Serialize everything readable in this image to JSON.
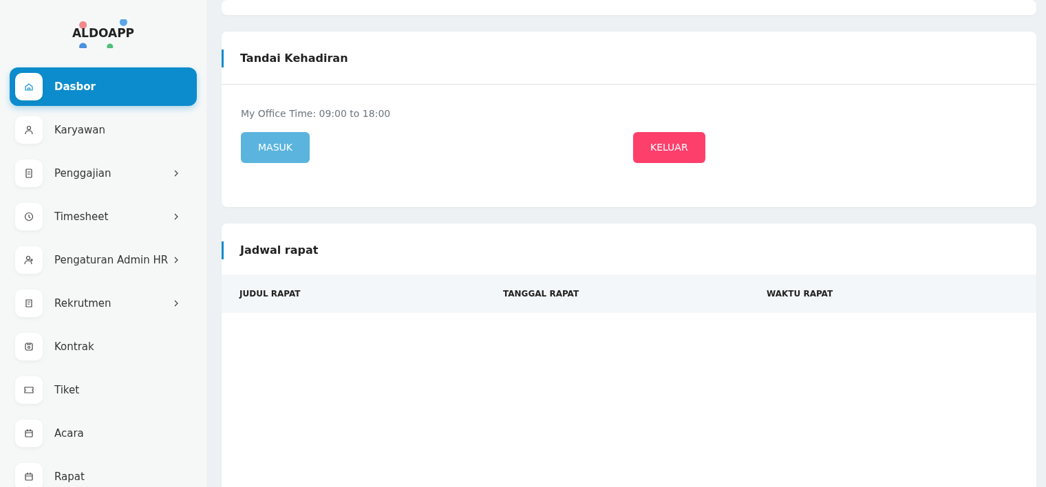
{
  "logo": {
    "text": "ALDOAPP"
  },
  "sidebar": {
    "items": [
      {
        "label": "Dasbor",
        "kind": "home",
        "selected": true,
        "submenu": false
      },
      {
        "label": "Karyawan",
        "kind": "user",
        "selected": false,
        "submenu": false
      },
      {
        "label": "Penggajian",
        "kind": "receipt",
        "selected": false,
        "submenu": true
      },
      {
        "label": "Timesheet",
        "kind": "clock",
        "selected": false,
        "submenu": true
      },
      {
        "label": "Pengaturan Admin HR",
        "kind": "adduser",
        "selected": false,
        "submenu": true
      },
      {
        "label": "Rekrutmen",
        "kind": "scroll",
        "selected": false,
        "submenu": true
      },
      {
        "label": "Kontrak",
        "kind": "floppy",
        "selected": false,
        "submenu": false
      },
      {
        "label": "Tiket",
        "kind": "ticket",
        "selected": false,
        "submenu": false
      },
      {
        "label": "Acara",
        "kind": "calendar",
        "selected": false,
        "submenu": false
      },
      {
        "label": "Rapat",
        "kind": "calendar",
        "selected": false,
        "submenu": false
      }
    ]
  },
  "attendance": {
    "title": "Tandai Kehadiran",
    "office_time": "My Office Time: 09:00 to 18:00",
    "buttons": [
      {
        "label": "MASUK",
        "kind": "in"
      },
      {
        "label": "KELUAR",
        "kind": "out"
      }
    ]
  },
  "meetings": {
    "title": "Jadwal rapat",
    "columns": [
      "JUDUL RAPAT",
      "TANGGAL RAPAT",
      "WAKTU RAPAT"
    ]
  }
}
